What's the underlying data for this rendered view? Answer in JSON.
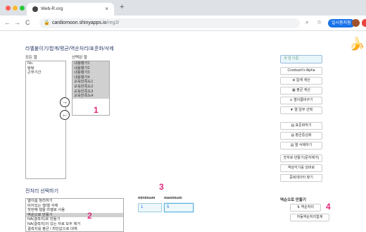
{
  "browser": {
    "tab_title": "Web-R.org",
    "tab_close": "×",
    "new_tab": "+",
    "back": "←",
    "forward": "→",
    "reload": "C",
    "url_host": "cardiomoon.shinyapps.io",
    "url_path": "/reg3/",
    "pause_label": "일시중지됨",
    "icons": [
      "back-arrow-icon",
      "forward-arrow-icon",
      "reload-icon",
      "lock-icon",
      "search-icon",
      "star-icon",
      "profile-icon"
    ]
  },
  "page": {
    "mascot_icon": "banana-mascot-icon",
    "section1_title": "라벨붙이기/합계/평균/역순처리/표준화/삭제",
    "all_cols_label": "모든 열",
    "all_cols": [
      "No.",
      "탕탕",
      "근무기간"
    ],
    "selected_cols_label": "선택된 열",
    "selected_cols": [
      "내용평가1",
      "내용평가2",
      "내용평가3",
      "내용평가4",
      "교육만족도1",
      "교육만족도2",
      "교육만족도3",
      "교육만족도4"
    ],
    "arrow_right": "→",
    "arrow_left": "←",
    "callouts": [
      "1",
      "2",
      "3",
      "4"
    ],
    "new_col_placeholder": "새 열 이름",
    "buttons_top": [
      "Cronbach's Alpha",
      "합계 계산",
      "평균 계산",
      "열이름바꾸기",
      "열 일부 선택"
    ],
    "button_icons": [
      "plus-circle-icon",
      "calculator-icon",
      "user-icon",
      "filter-icon"
    ],
    "buttons_mid": [
      "표준화하기",
      "평균중심화",
      "열 삭제하기"
    ],
    "mid_icons": [
      "table-icon",
      "table-icon",
      "table-icon"
    ],
    "buttons_bottom": [
      "숫자로 만들기(문자제거)",
      "역삼각기를 넘버로",
      "중복데이터 찾기"
    ],
    "section2_title": "전처리 선택하기",
    "prep_items": [
      "열이름 정리하기",
      "비어있는 행/열 삭제",
      "첫번째 행을 라벨로 사용",
      "역순으로 만들기",
      "NA(결측치)로 만들기",
      "NA(결측치)이 있는 자료 모두 제거",
      "결측치를 평균 / 최빈값으로 대체"
    ],
    "prep_selected_index": 3,
    "minimum_label": "minimum",
    "maximum_label": "maximum",
    "minimum_value": "1",
    "maximum_value": "5",
    "reverse_section_label": "역순으로 만들기",
    "reverse_button": "역순처리",
    "reverse_icon": "sort-icon",
    "auto_reverse_button": "자동역순처리함계"
  }
}
